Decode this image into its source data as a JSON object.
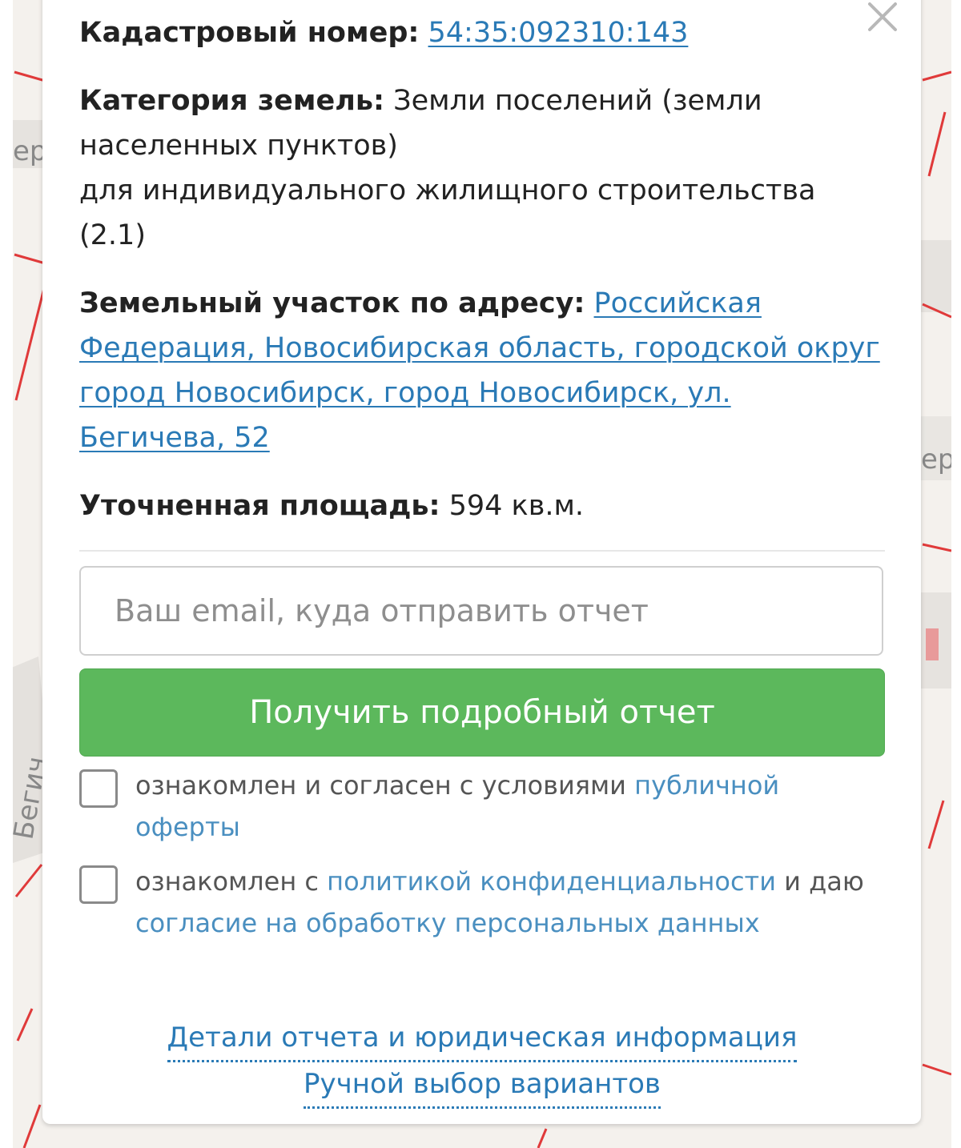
{
  "cadastre": {
    "label": "Кадастровый номер:",
    "number": "54:35:092310:143"
  },
  "category": {
    "label": "Категория земель:",
    "value": "Земли поселений (земли населенных пунктов)",
    "usage": "для индивидуального жилищного строительства (2.1)"
  },
  "address": {
    "label": "Земельный участок по адресу:",
    "value": "Российская Федерация, Новосибирская область, городской округ город Новосибирск, город Новосибирск, ул. Бегичева, 52"
  },
  "area": {
    "label": "Уточненная площадь:",
    "value": "594 кв.м."
  },
  "form": {
    "email_placeholder": "Ваш email, куда отправить отчет",
    "submit_label": "Получить подробный отчет"
  },
  "agreements": {
    "offer": {
      "text": "ознакомлен и согласен с условиями",
      "link": "публичной оферты"
    },
    "privacy": {
      "text_before": "ознакомлен с",
      "link_policy": "политикой конфиденциальности",
      "text_middle": "и даю",
      "link_consent": "согласие на обработку персональных данных"
    }
  },
  "footer": {
    "details_link": "Детали отчета и юридическая информация",
    "manual_link": "Ручной выбор вариантов"
  },
  "map": {
    "street_label_left_top": "ер",
    "street_label_right": "ер",
    "street_label_left": "Бегич"
  },
  "colors": {
    "link": "#2a7ab6",
    "submit_button": "#5cb85c",
    "map_boundary": "#e03a3a"
  },
  "icons": {
    "close": "close-icon"
  }
}
